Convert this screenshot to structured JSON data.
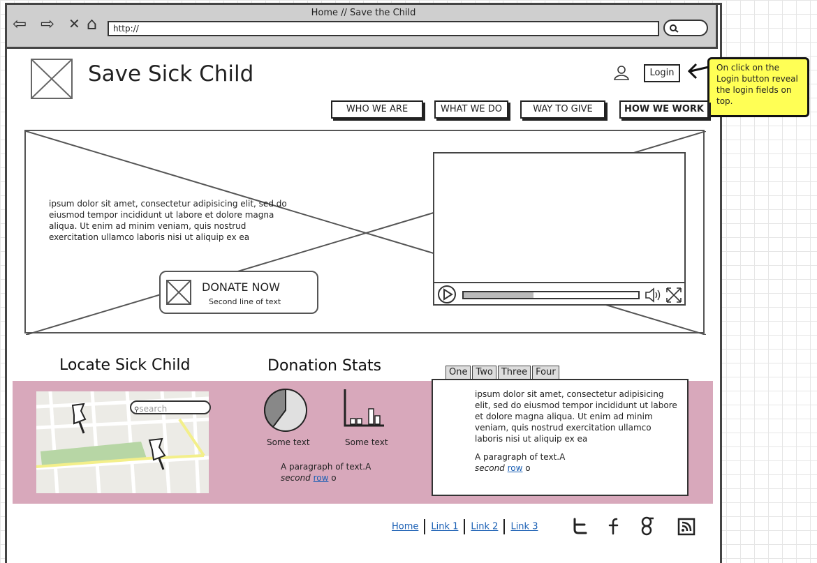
{
  "browser": {
    "title": "Home // Save the Child",
    "url": "http://"
  },
  "header": {
    "site_title": "Save Sick Child",
    "login_label": "Login"
  },
  "callout": {
    "text": "On click on the Login button reveal the login fields on top."
  },
  "nav": [
    {
      "label": "WHO WE ARE"
    },
    {
      "label": "WHAT WE DO"
    },
    {
      "label": "WAY TO GIVE"
    },
    {
      "label": "HOW WE WORK"
    }
  ],
  "hero": {
    "text": "ipsum dolor sit amet, consectetur adipisicing elit, sed do eiusmod tempor incididunt ut labore et dolore magna aliqua. Ut enim ad minim veniam, quis nostrud exercitation ullamco laboris nisi ut aliquip ex ea",
    "donate_title": "DONATE NOW",
    "donate_subtitle": "Second line of text"
  },
  "video": {
    "progress": 0.4
  },
  "locate": {
    "heading": "Locate Sick Child",
    "search_placeholder": "search"
  },
  "stats": {
    "heading": "Donation Stats",
    "pie_caption": "Some text",
    "bar_caption": "Some text",
    "paragraph_main": "A paragraph of text.A",
    "paragraph_em": "second",
    "paragraph_link": "row",
    "paragraph_tail": "o"
  },
  "tabs": {
    "items": [
      {
        "label": "One"
      },
      {
        "label": "Two"
      },
      {
        "label": "Three"
      },
      {
        "label": "Four"
      }
    ],
    "body": "ipsum dolor sit amet, consectetur adipisicing elit, sed do eiusmod tempor incididunt ut labore et dolore magna aliqua. Ut enim ad minim veniam, quis nostrud exercitation ullamco laboris nisi ut aliquip ex ea",
    "paragraph_main": "A paragraph of text.A",
    "paragraph_em": "second",
    "paragraph_link": "row",
    "paragraph_tail": "o"
  },
  "footer": {
    "links": [
      {
        "label": "Home"
      },
      {
        "label": "Link 1"
      },
      {
        "label": "Link 2"
      },
      {
        "label": "Link 3"
      }
    ],
    "social_icons": [
      "twitter-icon",
      "facebook-icon",
      "google-icon",
      "rss-icon"
    ]
  }
}
